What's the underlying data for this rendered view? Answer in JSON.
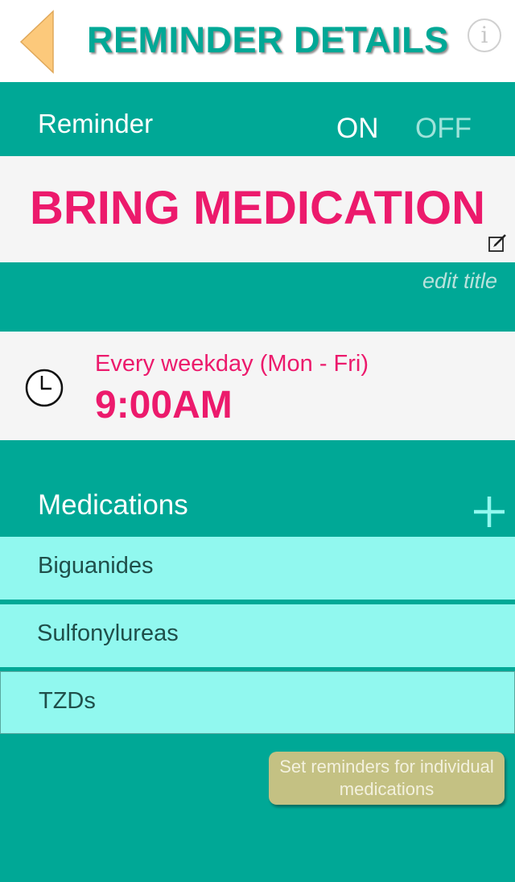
{
  "header": {
    "title": "REMINDER DETAILS",
    "back_icon": "back-arrow-icon",
    "info_icon": "info-icon",
    "info_glyph": "i"
  },
  "reminder": {
    "label": "Reminder",
    "on_label": "ON",
    "off_label": "OFF",
    "state": "ON",
    "title": "BRING MEDICATION",
    "edit_icon": "edit-icon",
    "edit_label": "edit title"
  },
  "schedule": {
    "icon": "clock-icon",
    "frequency": "Every weekday (Mon - Fri)",
    "time": "9:00AM"
  },
  "medications": {
    "label": "Medications",
    "add_icon": "plus-icon",
    "items": [
      {
        "name": "Biguanides"
      },
      {
        "name": "Sulfonylureas"
      },
      {
        "name": "TZDs"
      }
    ],
    "individual_button": "Set reminders for individual medications"
  },
  "colors": {
    "teal": "#00a896",
    "pink": "#ec1a6c",
    "light_teal": "#91f8ef",
    "back_arrow": "#fcc97b",
    "button": "#c4c183"
  }
}
